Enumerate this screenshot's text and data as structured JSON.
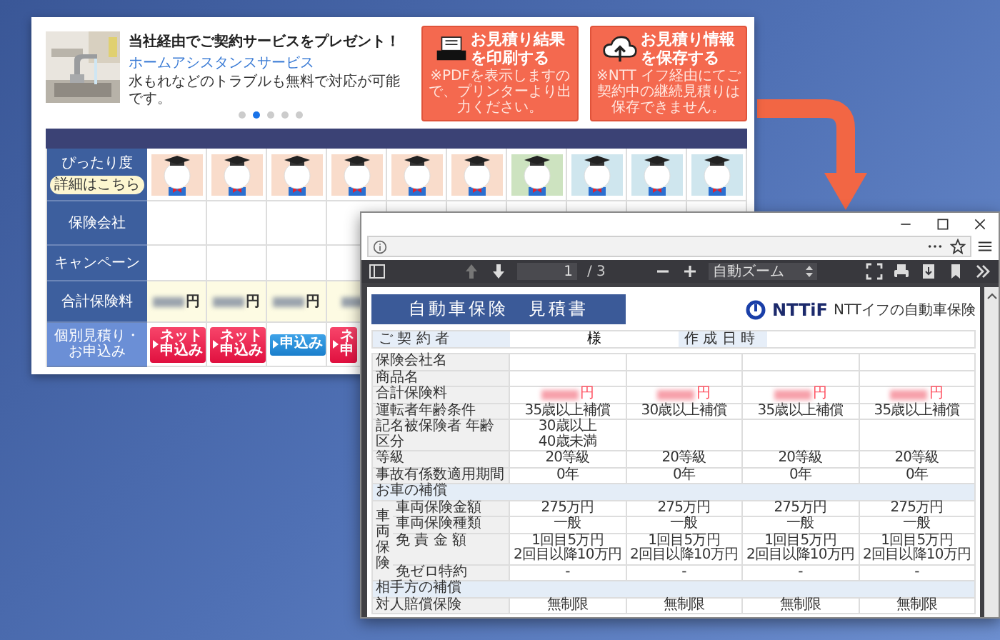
{
  "banner": {
    "title": "当社経由でご契約サービスをプレゼント！",
    "link": "ホームアシスタンスサービス",
    "description": "水もれなどのトラブルも無料で対応が可能です。",
    "dots": [
      {
        "selected": false
      },
      {
        "selected": true
      },
      {
        "selected": false
      },
      {
        "selected": false
      },
      {
        "selected": false
      }
    ]
  },
  "action_buttons": [
    {
      "kind": "print",
      "title_lines": [
        "お見積り結果",
        "を印刷する"
      ],
      "note": "※PDFを表示しますので、プリンターより出力ください。"
    },
    {
      "kind": "save",
      "title_lines": [
        "お見積り情報",
        "を保存する"
      ],
      "note": "※NTT イフ経由にてご契約中の継続見積りは保存できません。"
    }
  ],
  "comparison_table": {
    "fit": {
      "label": "ぴったり度",
      "detail_button": "詳細はこちら",
      "tiles": [
        {
          "color": "#f9dccb"
        },
        {
          "color": "#f9dccb"
        },
        {
          "color": "#f9dccb"
        },
        {
          "color": "#f9dccb"
        },
        {
          "color": "#f9dccb"
        },
        {
          "color": "#f9dccb"
        },
        {
          "color": "#cde3c0"
        },
        {
          "color": "#cfe6ee"
        },
        {
          "color": "#cfe6ee"
        },
        {
          "color": "#cfe6ee"
        }
      ]
    },
    "company": {
      "label": "保険会社"
    },
    "campaign": {
      "label": "キャンペーン"
    },
    "premium": {
      "label": "合計保険料",
      "cells": [
        {
          "kind": "amount",
          "unit": "円"
        },
        {
          "kind": "amount",
          "unit": "円"
        },
        {
          "kind": "amount",
          "unit": "円"
        },
        {
          "kind": "amount_cut"
        }
      ]
    },
    "apply": {
      "label": "個別見積り・お申込み",
      "buttons": [
        {
          "kind": "net",
          "label_lines": [
            "ネット",
            "申込み"
          ]
        },
        {
          "kind": "net",
          "label_lines": [
            "ネット",
            "申込み"
          ]
        },
        {
          "kind": "apply",
          "label_lines": [
            "申込み"
          ]
        },
        {
          "kind": "net",
          "label_lines": [
            "ネ",
            "申"
          ]
        }
      ]
    }
  },
  "pdf_viewer": {
    "page": "1",
    "page_count": "/ 3",
    "zoom": "自動ズーム"
  },
  "document": {
    "title": "自動車保険　見積書",
    "logo": "NTTiF",
    "tagline": "NTTイフの自動車保険",
    "contract": {
      "label": "ご 契 約 者",
      "suffix": "様",
      "date_label": "作 成 日 時"
    },
    "rows": [
      {
        "kind": "row",
        "label": "保険会社名"
      },
      {
        "kind": "row",
        "label": "商品名"
      },
      {
        "kind": "premium",
        "label": "合計保険料",
        "units": [
          "円",
          "円",
          "円",
          "円"
        ]
      },
      {
        "kind": "row",
        "label": "運転者年齢条件",
        "values": [
          "35歳以上補償",
          "30歳以上補償",
          "35歳以上補償",
          "35歳以上補償"
        ]
      },
      {
        "kind": "row",
        "label": "記名被保険者 年齢区分",
        "values": [
          "30歳以上\n40歳未満"
        ]
      },
      {
        "kind": "row",
        "label": "等級",
        "values": [
          "20等級",
          "20等級",
          "20等級",
          "20等級"
        ]
      },
      {
        "kind": "row",
        "label": "事故有係数適用期間",
        "values": [
          "0年",
          "0年",
          "0年",
          "0年"
        ]
      },
      {
        "kind": "section",
        "label": "お車の補償"
      },
      {
        "kind": "group",
        "label": "車両保険",
        "rows": [
          {
            "label": "車両保険金額",
            "values": [
              "275万円",
              "275万円",
              "275万円",
              "275万円"
            ]
          },
          {
            "label": "車両保険種類",
            "values": [
              "一般",
              "一般",
              "一般",
              "一般"
            ]
          },
          {
            "label": "免 責 金 額",
            "values": [
              "1回目5万円\n2回目以降10万円",
              "1回目5万円\n2回目以降10万円",
              "1回目5万円\n2回目以降10万円",
              "1回目5万円\n2回目以降10万円"
            ]
          },
          {
            "label": "免ゼロ特約",
            "values": [
              "-",
              "-",
              "-",
              "-"
            ]
          }
        ]
      },
      {
        "kind": "section",
        "label": "相手方の補償"
      },
      {
        "kind": "row",
        "label": "対人賠償保険",
        "values": [
          "無制限",
          "無制限",
          "無制限",
          "無制限"
        ]
      }
    ]
  }
}
